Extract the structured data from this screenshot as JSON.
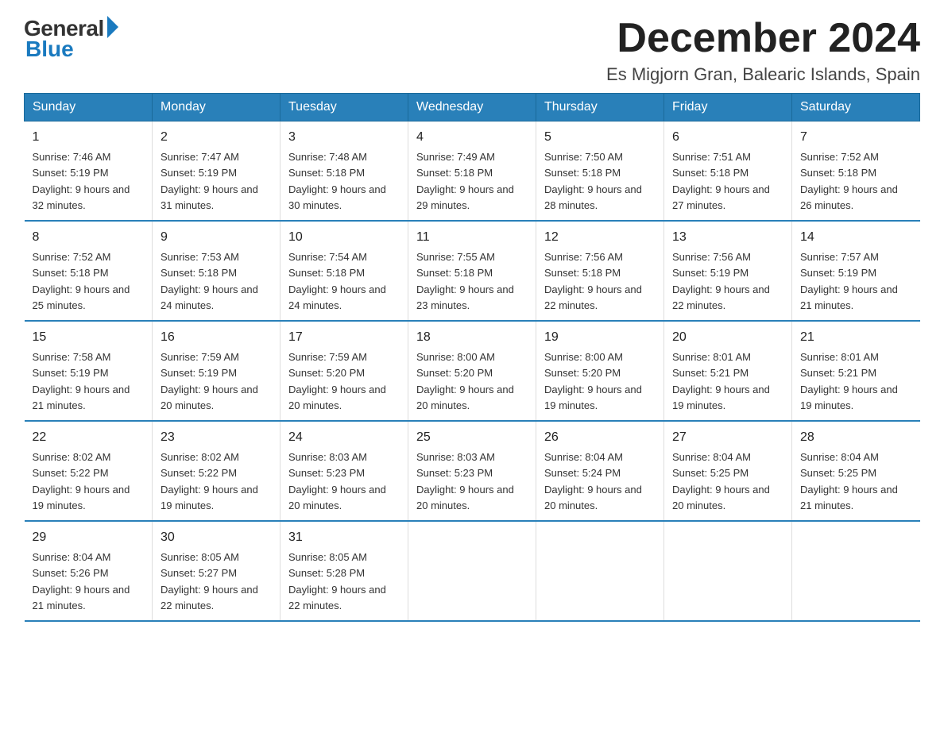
{
  "logo": {
    "general": "General",
    "blue": "Blue"
  },
  "header": {
    "month_year": "December 2024",
    "location": "Es Migjorn Gran, Balearic Islands, Spain"
  },
  "days_of_week": [
    "Sunday",
    "Monday",
    "Tuesday",
    "Wednesday",
    "Thursday",
    "Friday",
    "Saturday"
  ],
  "weeks": [
    [
      {
        "day": "1",
        "sunrise": "7:46 AM",
        "sunset": "5:19 PM",
        "daylight": "9 hours and 32 minutes."
      },
      {
        "day": "2",
        "sunrise": "7:47 AM",
        "sunset": "5:19 PM",
        "daylight": "9 hours and 31 minutes."
      },
      {
        "day": "3",
        "sunrise": "7:48 AM",
        "sunset": "5:18 PM",
        "daylight": "9 hours and 30 minutes."
      },
      {
        "day": "4",
        "sunrise": "7:49 AM",
        "sunset": "5:18 PM",
        "daylight": "9 hours and 29 minutes."
      },
      {
        "day": "5",
        "sunrise": "7:50 AM",
        "sunset": "5:18 PM",
        "daylight": "9 hours and 28 minutes."
      },
      {
        "day": "6",
        "sunrise": "7:51 AM",
        "sunset": "5:18 PM",
        "daylight": "9 hours and 27 minutes."
      },
      {
        "day": "7",
        "sunrise": "7:52 AM",
        "sunset": "5:18 PM",
        "daylight": "9 hours and 26 minutes."
      }
    ],
    [
      {
        "day": "8",
        "sunrise": "7:52 AM",
        "sunset": "5:18 PM",
        "daylight": "9 hours and 25 minutes."
      },
      {
        "day": "9",
        "sunrise": "7:53 AM",
        "sunset": "5:18 PM",
        "daylight": "9 hours and 24 minutes."
      },
      {
        "day": "10",
        "sunrise": "7:54 AM",
        "sunset": "5:18 PM",
        "daylight": "9 hours and 24 minutes."
      },
      {
        "day": "11",
        "sunrise": "7:55 AM",
        "sunset": "5:18 PM",
        "daylight": "9 hours and 23 minutes."
      },
      {
        "day": "12",
        "sunrise": "7:56 AM",
        "sunset": "5:18 PM",
        "daylight": "9 hours and 22 minutes."
      },
      {
        "day": "13",
        "sunrise": "7:56 AM",
        "sunset": "5:19 PM",
        "daylight": "9 hours and 22 minutes."
      },
      {
        "day": "14",
        "sunrise": "7:57 AM",
        "sunset": "5:19 PM",
        "daylight": "9 hours and 21 minutes."
      }
    ],
    [
      {
        "day": "15",
        "sunrise": "7:58 AM",
        "sunset": "5:19 PM",
        "daylight": "9 hours and 21 minutes."
      },
      {
        "day": "16",
        "sunrise": "7:59 AM",
        "sunset": "5:19 PM",
        "daylight": "9 hours and 20 minutes."
      },
      {
        "day": "17",
        "sunrise": "7:59 AM",
        "sunset": "5:20 PM",
        "daylight": "9 hours and 20 minutes."
      },
      {
        "day": "18",
        "sunrise": "8:00 AM",
        "sunset": "5:20 PM",
        "daylight": "9 hours and 20 minutes."
      },
      {
        "day": "19",
        "sunrise": "8:00 AM",
        "sunset": "5:20 PM",
        "daylight": "9 hours and 19 minutes."
      },
      {
        "day": "20",
        "sunrise": "8:01 AM",
        "sunset": "5:21 PM",
        "daylight": "9 hours and 19 minutes."
      },
      {
        "day": "21",
        "sunrise": "8:01 AM",
        "sunset": "5:21 PM",
        "daylight": "9 hours and 19 minutes."
      }
    ],
    [
      {
        "day": "22",
        "sunrise": "8:02 AM",
        "sunset": "5:22 PM",
        "daylight": "9 hours and 19 minutes."
      },
      {
        "day": "23",
        "sunrise": "8:02 AM",
        "sunset": "5:22 PM",
        "daylight": "9 hours and 19 minutes."
      },
      {
        "day": "24",
        "sunrise": "8:03 AM",
        "sunset": "5:23 PM",
        "daylight": "9 hours and 20 minutes."
      },
      {
        "day": "25",
        "sunrise": "8:03 AM",
        "sunset": "5:23 PM",
        "daylight": "9 hours and 20 minutes."
      },
      {
        "day": "26",
        "sunrise": "8:04 AM",
        "sunset": "5:24 PM",
        "daylight": "9 hours and 20 minutes."
      },
      {
        "day": "27",
        "sunrise": "8:04 AM",
        "sunset": "5:25 PM",
        "daylight": "9 hours and 20 minutes."
      },
      {
        "day": "28",
        "sunrise": "8:04 AM",
        "sunset": "5:25 PM",
        "daylight": "9 hours and 21 minutes."
      }
    ],
    [
      {
        "day": "29",
        "sunrise": "8:04 AM",
        "sunset": "5:26 PM",
        "daylight": "9 hours and 21 minutes."
      },
      {
        "day": "30",
        "sunrise": "8:05 AM",
        "sunset": "5:27 PM",
        "daylight": "9 hours and 22 minutes."
      },
      {
        "day": "31",
        "sunrise": "8:05 AM",
        "sunset": "5:28 PM",
        "daylight": "9 hours and 22 minutes."
      },
      null,
      null,
      null,
      null
    ]
  ]
}
